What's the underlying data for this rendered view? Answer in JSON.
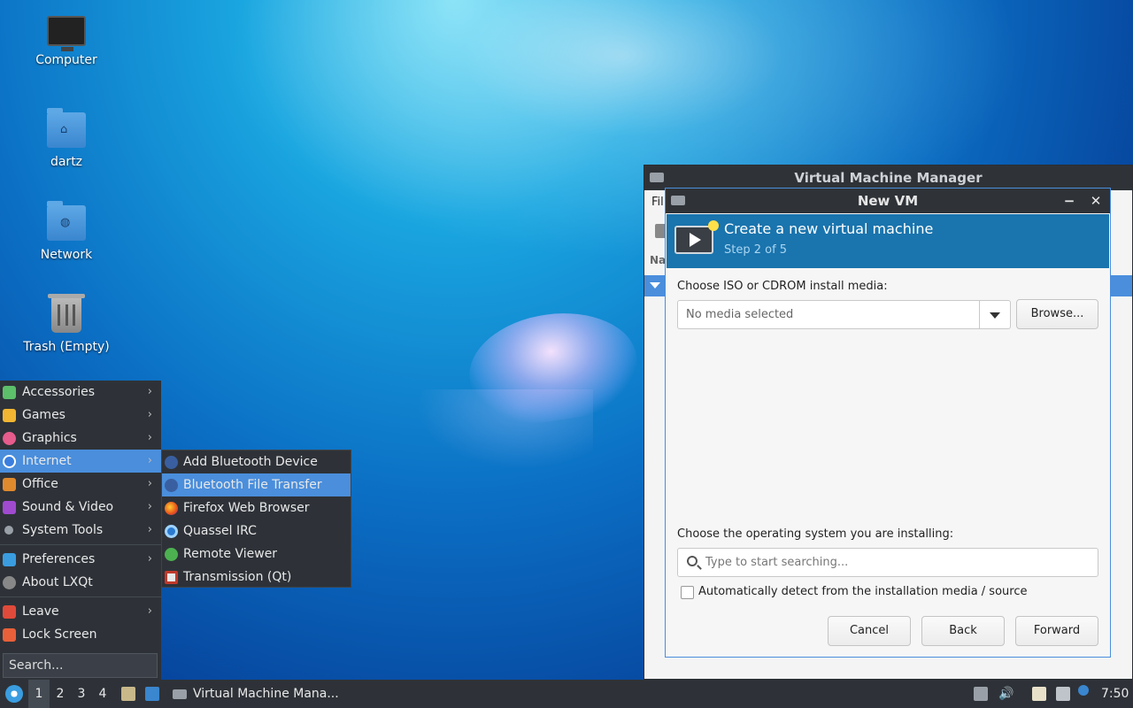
{
  "desktop": {
    "icons": [
      {
        "label": "Computer"
      },
      {
        "label": "dartz"
      },
      {
        "label": "Network"
      },
      {
        "label": "Trash (Empty)"
      }
    ]
  },
  "menu": {
    "items": [
      {
        "label": "Accessories",
        "icon": "accessories-icon",
        "color": "#5cbf6a"
      },
      {
        "label": "Games",
        "icon": "games-icon",
        "color": "#f2b632"
      },
      {
        "label": "Graphics",
        "icon": "graphics-icon",
        "color": "#e65c8c"
      },
      {
        "label": "Internet",
        "icon": "internet-icon",
        "color": "#3a7fe0"
      },
      {
        "label": "Office",
        "icon": "office-icon",
        "color": "#e08a2e"
      },
      {
        "label": "Sound & Video",
        "icon": "sound-video-icon",
        "color": "#a04ad0"
      },
      {
        "label": "System Tools",
        "icon": "system-tools-icon",
        "color": "#9aa0a8"
      },
      {
        "label": "Preferences",
        "icon": "preferences-icon",
        "color": "#3a9de0"
      },
      {
        "label": "About LXQt",
        "icon": "info-icon",
        "color": "#888888"
      },
      {
        "label": "Leave",
        "icon": "power-icon",
        "color": "#e04a3a"
      },
      {
        "label": "Lock Screen",
        "icon": "lock-icon",
        "color": "#e8603a"
      }
    ],
    "search_placeholder": "Search..."
  },
  "submenu": {
    "items": [
      {
        "label": "Add Bluetooth Device",
        "icon": "bluetooth-icon"
      },
      {
        "label": "Bluetooth File Transfer",
        "icon": "bluetooth-icon"
      },
      {
        "label": "Firefox Web Browser",
        "icon": "firefox-icon"
      },
      {
        "label": "Quassel IRC",
        "icon": "quassel-icon"
      },
      {
        "label": "Remote Viewer",
        "icon": "remote-viewer-icon"
      },
      {
        "label": "Transmission (Qt)",
        "icon": "transmission-icon"
      }
    ]
  },
  "vmm": {
    "title": "Virtual Machine Manager",
    "menu_partial": "Fil",
    "col_partial": "Na"
  },
  "dialog": {
    "title": "New VM",
    "header_title": "Create a new virtual machine",
    "header_step": "Step 2 of 5",
    "media_label": "Choose ISO or CDROM install media:",
    "media_placeholder": "No media selected",
    "browse": "Browse...",
    "os_label": "Choose the operating system you are installing:",
    "os_placeholder": "Type to start searching...",
    "auto_detect": "Automatically detect from the installation media / source",
    "cancel": "Cancel",
    "back": "Back",
    "forward": "Forward"
  },
  "taskbar": {
    "workspaces": [
      "1",
      "2",
      "3",
      "4"
    ],
    "task_label": "Virtual Machine Mana...",
    "clock": "7:50"
  }
}
